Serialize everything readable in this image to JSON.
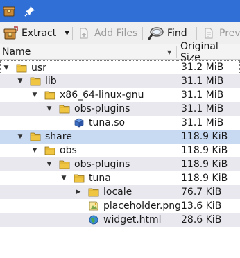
{
  "toolbar": {
    "extract_label": "Extract",
    "add_files_label": "Add Files",
    "find_label": "Find",
    "preview_label": "Prev"
  },
  "header": {
    "name_label": "Name",
    "size_label": "Original Size"
  },
  "colors": {
    "titlebar": "#2f6fd6",
    "selection": "#c8daf2",
    "folder": "#f0c542"
  },
  "tree": [
    {
      "name": "usr",
      "size": "31.2 MiB",
      "type": "folder",
      "expanded": true
    },
    {
      "name": "lib",
      "size": "31.1 MiB",
      "type": "folder",
      "expanded": true
    },
    {
      "name": "x86_64-linux-gnu",
      "size": "31.1 MiB",
      "type": "folder",
      "expanded": true
    },
    {
      "name": "obs-plugins",
      "size": "31.1 MiB",
      "type": "folder",
      "expanded": true
    },
    {
      "name": "tuna.so",
      "size": "31.1 MiB",
      "type": "library-file"
    },
    {
      "name": "share",
      "size": "118.9 KiB",
      "type": "folder",
      "expanded": true
    },
    {
      "name": "obs",
      "size": "118.9 KiB",
      "type": "folder",
      "expanded": true
    },
    {
      "name": "obs-plugins",
      "size": "118.9 KiB",
      "type": "folder",
      "expanded": true
    },
    {
      "name": "tuna",
      "size": "118.9 KiB",
      "type": "folder",
      "expanded": true
    },
    {
      "name": "locale",
      "size": "76.7 KiB",
      "type": "folder",
      "expanded": false
    },
    {
      "name": "placeholder.png",
      "size": "13.6 KiB",
      "type": "image-file"
    },
    {
      "name": "widget.html",
      "size": "28.6 KiB",
      "type": "html-file"
    }
  ]
}
